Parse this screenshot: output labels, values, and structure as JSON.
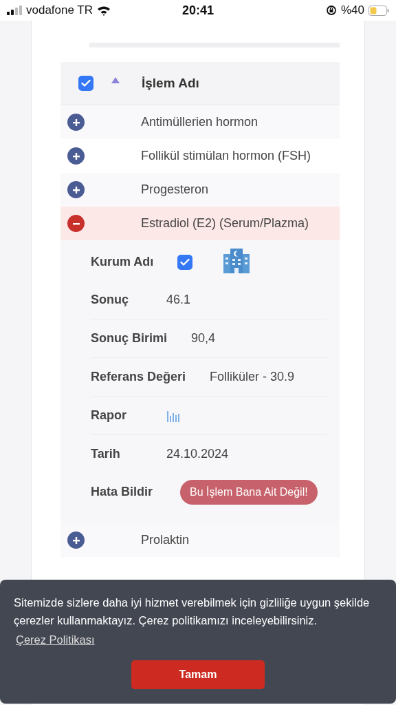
{
  "status_bar": {
    "carrier": "vodafone TR",
    "time": "20:41",
    "battery": "%40"
  },
  "table": {
    "header": {
      "checked": true,
      "sorted_ascending": true,
      "title": "İşlem Adı"
    },
    "rows": [
      {
        "name": "Antimüllerien hormon",
        "expanded": false
      },
      {
        "name": "Follikül stimülan hormon (FSH)",
        "expanded": false
      },
      {
        "name": "Progesteron",
        "expanded": false
      },
      {
        "name": "Estradiol (E2) (Serum/Plazma)",
        "expanded": true,
        "details": [
          {
            "kind": "institution",
            "label": "Kurum Adı",
            "checked": true
          },
          {
            "kind": "text",
            "label": "Sonuç",
            "value": "46.1"
          },
          {
            "kind": "text",
            "label": "Sonuç Birimi",
            "value": "90,4"
          },
          {
            "kind": "text",
            "label": "Referans Değeri",
            "value": "Folliküler - 30.9"
          },
          {
            "kind": "report",
            "label": "Rapor"
          },
          {
            "kind": "text",
            "label": "Tarih",
            "value": "24.10.2024"
          },
          {
            "kind": "button",
            "label": "Hata Bildir",
            "value": "Bu İşlem Bana Ait Değil!"
          }
        ]
      },
      {
        "name": "Prolaktin",
        "expanded": false
      }
    ]
  },
  "cookie_banner": {
    "message": "Sitemizde sizlere daha iyi hizmet verebilmek için gizliliğe uygun şekilde çerezler kullanmaktayız. Çerez politikamızı inceleyebilirsiniz.",
    "link": "Çerez Politikası",
    "button": "Tamam"
  }
}
